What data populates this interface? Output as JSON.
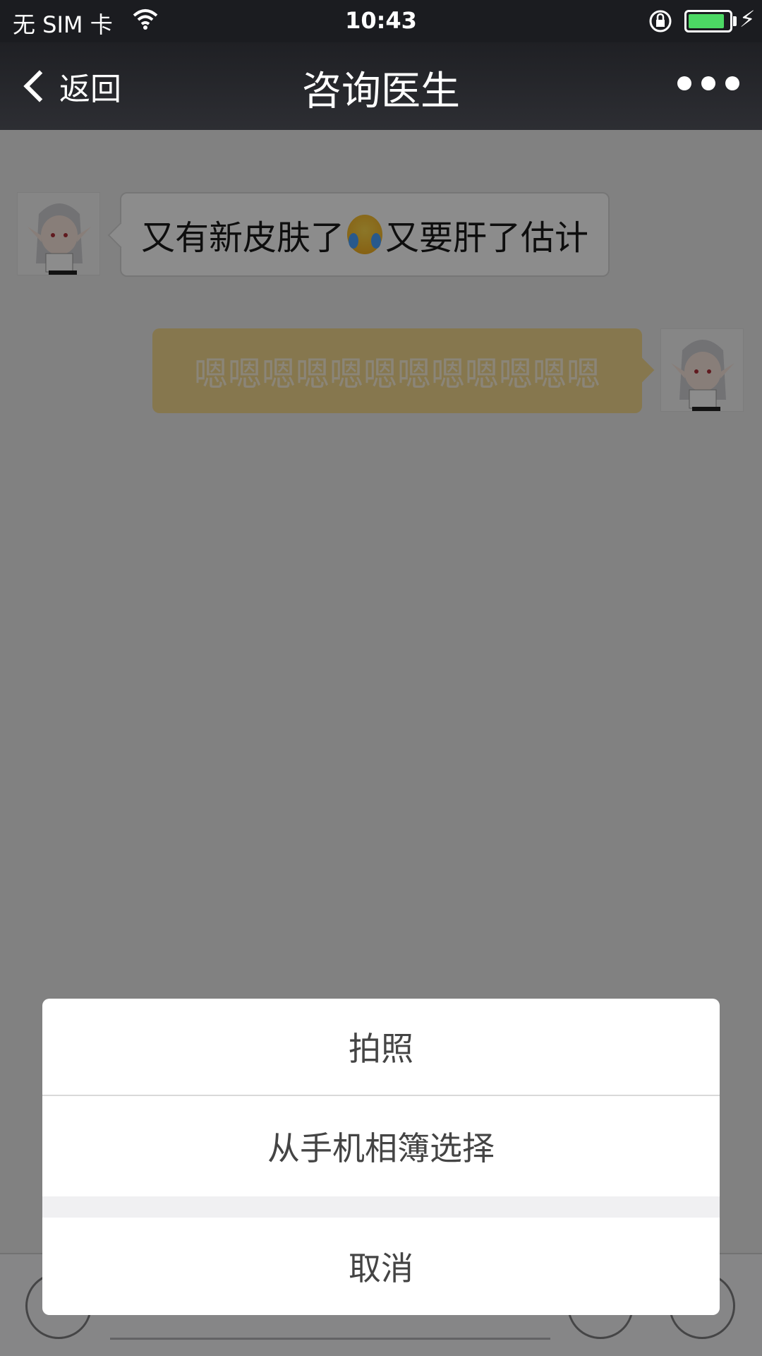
{
  "status_bar": {
    "carrier": "无 SIM 卡",
    "time": "10:43",
    "battery_level": 0.9,
    "icons": [
      "wifi-icon",
      "rotation-lock-icon",
      "battery-icon",
      "charging-bolt-icon"
    ]
  },
  "nav": {
    "back_label": "返回",
    "title": "咨询医生",
    "more_icon": "more-dots-icon"
  },
  "messages": [
    {
      "side": "left",
      "text_before": "又有新皮肤了",
      "emoji": "crying-laughing-emoji",
      "text_after": "又要肝了估计"
    },
    {
      "side": "right",
      "text": "嗯嗯嗯嗯嗯嗯嗯嗯嗯嗯嗯嗯"
    }
  ],
  "action_sheet": {
    "take_photo": "拍照",
    "choose_from_album": "从手机相簿选择",
    "cancel": "取消"
  },
  "colors": {
    "nav_bg": "#1f2024",
    "outgoing_bubble": "#f5d98f",
    "battery_fill": "#4cd964",
    "overlay": "rgba(0,0,0,0.45)"
  }
}
